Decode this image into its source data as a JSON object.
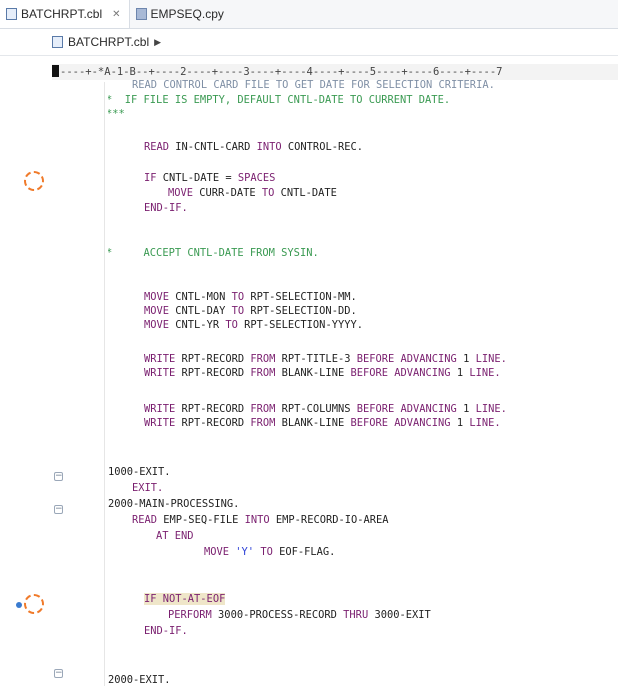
{
  "tabs": [
    {
      "label": "BATCHRPT.cbl",
      "active": true,
      "close": "✕"
    },
    {
      "label": "EMPSEQ.cpy",
      "active": false
    }
  ],
  "breadcrumb": {
    "label": "BATCHRPT.cbl",
    "arrow": "▶"
  },
  "ruler": {
    "text": "----+-*A-1-B--+----2----+----3----+----4----+----5----+----6----+----7"
  },
  "code": {
    "l0": "READ CONTROL CARD FILE TO GET DATE FOR SELECTION CRITERIA.",
    "l1a": "*",
    "l1b": "IF FILE IS EMPTY, DEFAULT CNTL-DATE TO CURRENT DATE.",
    "l2": "***",
    "l3a": "READ",
    "l3b": " IN-CNTL-CARD ",
    "l3c": "INTO",
    "l3d": " CONTROL-REC.",
    "l4a": "IF",
    "l4b": " CNTL-DATE = ",
    "l4c": "SPACES",
    "l5a": "MOVE",
    "l5b": " CURR-DATE ",
    "l5c": "TO",
    "l5d": " CNTL-DATE",
    "l6": "END-IF.",
    "l7a": "*",
    "l7b": "ACCEPT CNTL-DATE FROM SYSIN.",
    "l8a": "MOVE",
    "l8b": " CNTL-MON ",
    "l8c": "TO",
    "l8d": " RPT-SELECTION-MM.",
    "l9a": "MOVE",
    "l9b": " CNTL-DAY ",
    "l9c": "TO",
    "l9d": " RPT-SELECTION-DD.",
    "l10a": "MOVE",
    "l10b": " CNTL-YR ",
    "l10c": "TO",
    "l10d": " RPT-SELECTION-YYYY.",
    "l11a": "WRITE",
    "l11b": " RPT-RECORD ",
    "l11c": "FROM",
    "l11d": " RPT-TITLE-3 ",
    "l11e": "BEFORE ADVANCING",
    "l11f": " 1 ",
    "l11g": "LINE.",
    "l12a": "WRITE",
    "l12b": " RPT-RECORD ",
    "l12c": "FROM",
    "l12d": " BLANK-LINE ",
    "l12e": "BEFORE ADVANCING",
    "l12f": " 1 ",
    "l12g": "LINE.",
    "l13a": "WRITE",
    "l13b": " RPT-RECORD ",
    "l13c": "FROM",
    "l13d": " RPT-COLUMNS ",
    "l13e": "BEFORE ADVANCING",
    "l13f": " 1 ",
    "l13g": "LINE.",
    "l14a": "WRITE",
    "l14b": " RPT-RECORD ",
    "l14c": "FROM",
    "l14d": " BLANK-LINE ",
    "l14e": "BEFORE ADVANCING",
    "l14f": " 1 ",
    "l14g": "LINE.",
    "l15": "1000-EXIT.",
    "l16": "EXIT.",
    "l17": "2000-MAIN-PROCESSING.",
    "l18a": "READ",
    "l18b": " EMP-SEQ-FILE ",
    "l18c": "INTO",
    "l18d": " EMP-RECORD-IO-AREA",
    "l19": "AT END",
    "l20a": "MOVE",
    "l20b": " 'Y' ",
    "l20c": "TO",
    "l20d": " EOF-FLAG.",
    "l21a": "IF",
    "l21b": " NOT-AT-EOF",
    "l22a": "PERFORM",
    "l22b": " 3000-PROCESS-RECORD ",
    "l22c": "THRU",
    "l22d": " 3000-EXIT",
    "l23": "END-IF.",
    "l24": "2000-EXIT."
  },
  "colors": {
    "keyword": "#7a1f6f",
    "comment": "#3a9a52",
    "literal": "#2a3fd6",
    "highlight": "#efe6c9",
    "marker": "#f07a2a"
  }
}
